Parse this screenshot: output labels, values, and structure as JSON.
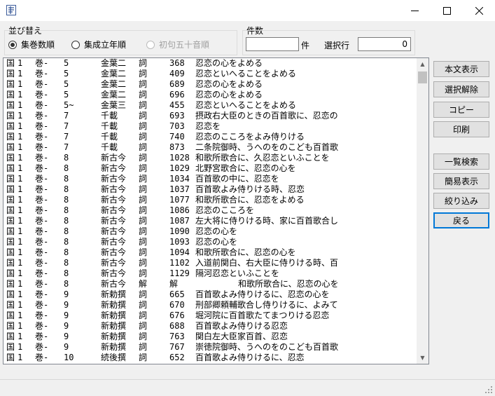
{
  "window": {
    "icon": "app-icon"
  },
  "sort": {
    "label": "並び替え",
    "options": [
      {
        "label": "集巻数順",
        "selected": true,
        "enabled": true
      },
      {
        "label": "集成立年順",
        "selected": false,
        "enabled": true
      },
      {
        "label": "初句五十音順",
        "selected": false,
        "enabled": false
      }
    ]
  },
  "count": {
    "label": "件数",
    "value": "",
    "unit": "件",
    "selected_label": "選択行",
    "selected_value": "0"
  },
  "buttons": {
    "show_text": "本文表示",
    "deselect": "選択解除",
    "copy": "コピー",
    "print": "印刷",
    "list_search": "一覧検索",
    "simple_view": "簡易表示",
    "narrow": "絞り込み",
    "back": "戻る"
  },
  "rows": [
    [
      "国",
      "1",
      "巻-",
      "5",
      "金葉二",
      "詞",
      "368",
      "忍恋の心をよめる"
    ],
    [
      "国",
      "1",
      "巻-",
      "5",
      "金葉二",
      "詞",
      "409",
      "忍恋といへることをよめる"
    ],
    [
      "国",
      "1",
      "巻-",
      "5",
      "金葉二",
      "詞",
      "689",
      "忍恋の心をよめる"
    ],
    [
      "国",
      "1",
      "巻-",
      "5",
      "金葉二",
      "詞",
      "696",
      "忍恋の心をよめる"
    ],
    [
      "国",
      "1",
      "巻-",
      "5~",
      "金葉三",
      "詞",
      "455",
      "忍恋といへることをよめる"
    ],
    [
      "国",
      "1",
      "巻-",
      "7",
      "千載",
      "詞",
      "693",
      "摂政右大臣のときの百首歌に、忍恋の"
    ],
    [
      "国",
      "1",
      "巻-",
      "7",
      "千載",
      "詞",
      "703",
      "忍恋を"
    ],
    [
      "国",
      "1",
      "巻-",
      "7",
      "千載",
      "詞",
      "740",
      "忍恋のこころをよみ侍りける"
    ],
    [
      "国",
      "1",
      "巻-",
      "7",
      "千載",
      "詞",
      "873",
      "二条院御時、うへのをのこども百首歌"
    ],
    [
      "国",
      "1",
      "巻-",
      "8",
      "新古今",
      "詞",
      "1028",
      "和歌所歌合に、久忍恋といふことを"
    ],
    [
      "国",
      "1",
      "巻-",
      "8",
      "新古今",
      "詞",
      "1029",
      "北野宮歌合に、忍恋の心を"
    ],
    [
      "国",
      "1",
      "巻-",
      "8",
      "新古今",
      "詞",
      "1034",
      "百首歌の中に、忍恋を"
    ],
    [
      "国",
      "1",
      "巻-",
      "8",
      "新古今",
      "詞",
      "1037",
      "百首歌よみ侍りける時、忍恋"
    ],
    [
      "国",
      "1",
      "巻-",
      "8",
      "新古今",
      "詞",
      "1077",
      "和歌所歌合に、忍恋をよめる"
    ],
    [
      "国",
      "1",
      "巻-",
      "8",
      "新古今",
      "詞",
      "1086",
      "忍恋のこころを"
    ],
    [
      "国",
      "1",
      "巻-",
      "8",
      "新古今",
      "詞",
      "1087",
      "左大将に侍りける時、家に百首歌合し"
    ],
    [
      "国",
      "1",
      "巻-",
      "8",
      "新古今",
      "詞",
      "1090",
      "忍恋の心を"
    ],
    [
      "国",
      "1",
      "巻-",
      "8",
      "新古今",
      "詞",
      "1093",
      "忍恋の心を"
    ],
    [
      "国",
      "1",
      "巻-",
      "8",
      "新古今",
      "詞",
      "1094",
      "和歌所歌合に、忍恋の心を"
    ],
    [
      "国",
      "1",
      "巻-",
      "8",
      "新古今",
      "詞",
      "1102",
      "入道前関白、右大臣に侍りける時、百"
    ],
    [
      "国",
      "1",
      "巻-",
      "8",
      "新古今",
      "詞",
      "1129",
      "隔河忍恋といふことを"
    ],
    [
      "国",
      "1",
      "巻-",
      "8",
      "新古今",
      "解",
      "解",
      "",
      "和歌所歌合に、忍恋の心を"
    ],
    [
      "国",
      "1",
      "巻-",
      "9",
      "新勅撰",
      "詞",
      "665",
      "百首歌よみ侍りけるに、忍恋の心を"
    ],
    [
      "国",
      "1",
      "巻-",
      "9",
      "新勅撰",
      "詞",
      "670",
      "刑部卿頼輔歌合し侍りけるに、よみて"
    ],
    [
      "国",
      "1",
      "巻-",
      "9",
      "新勅撰",
      "詞",
      "676",
      "堀河院に百首歌たてまつりける忍恋"
    ],
    [
      "国",
      "1",
      "巻-",
      "9",
      "新勅撰",
      "詞",
      "688",
      "百首歌よみ侍りける忍恋"
    ],
    [
      "国",
      "1",
      "巻-",
      "9",
      "新勅撰",
      "詞",
      "763",
      "関白左大臣家百首、忍恋"
    ],
    [
      "国",
      "1",
      "巻-",
      "9",
      "新勅撰",
      "詞",
      "767",
      "崇徳院御時、うへのをのこども百首歌"
    ],
    [
      "国",
      "1",
      "巻-",
      "10",
      "続後撰",
      "詞",
      "652",
      "百首歌よみ侍りけるに、忍恋"
    ]
  ]
}
